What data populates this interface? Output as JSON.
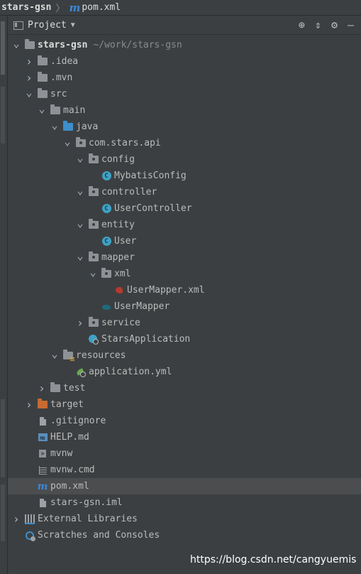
{
  "breadcrumb": {
    "project": "stars-gsn",
    "file": "pom.xml"
  },
  "panel": {
    "title": "Project"
  },
  "tree": [
    {
      "id": "root",
      "label": "stars-gsn",
      "path": "~/work/stars-gsn",
      "depth": 0,
      "arrow": "down",
      "icon": "module",
      "bold": true
    },
    {
      "id": "idea",
      "label": ".idea",
      "depth": 1,
      "arrow": "right",
      "icon": "folder"
    },
    {
      "id": "mvn",
      "label": ".mvn",
      "depth": 1,
      "arrow": "right",
      "icon": "folder"
    },
    {
      "id": "src",
      "label": "src",
      "depth": 1,
      "arrow": "down",
      "icon": "folder"
    },
    {
      "id": "main",
      "label": "main",
      "depth": 2,
      "arrow": "down",
      "icon": "folder"
    },
    {
      "id": "java",
      "label": "java",
      "depth": 3,
      "arrow": "down",
      "icon": "folder-blue"
    },
    {
      "id": "pkg",
      "label": "com.stars.api",
      "depth": 4,
      "arrow": "down",
      "icon": "package"
    },
    {
      "id": "config",
      "label": "config",
      "depth": 5,
      "arrow": "down",
      "icon": "package"
    },
    {
      "id": "mybatisconfig",
      "label": "MybatisConfig",
      "depth": 6,
      "icon": "class"
    },
    {
      "id": "controller",
      "label": "controller",
      "depth": 5,
      "arrow": "down",
      "icon": "package"
    },
    {
      "id": "usercontroller",
      "label": "UserController",
      "depth": 6,
      "icon": "class"
    },
    {
      "id": "entity",
      "label": "entity",
      "depth": 5,
      "arrow": "down",
      "icon": "package"
    },
    {
      "id": "user",
      "label": "User",
      "depth": 6,
      "icon": "class"
    },
    {
      "id": "mapper",
      "label": "mapper",
      "depth": 5,
      "arrow": "down",
      "icon": "package"
    },
    {
      "id": "xml",
      "label": "xml",
      "depth": 6,
      "arrow": "down",
      "icon": "package"
    },
    {
      "id": "usermapperxml",
      "label": "UserMapper.xml",
      "depth": 7,
      "icon": "mybatis-xml"
    },
    {
      "id": "usermapper",
      "label": "UserMapper",
      "depth": 6,
      "icon": "mybatis-mapper"
    },
    {
      "id": "service",
      "label": "service",
      "depth": 5,
      "arrow": "right",
      "icon": "package"
    },
    {
      "id": "starsapp",
      "label": "StarsApplication",
      "depth": 5,
      "icon": "spring-app"
    },
    {
      "id": "resources",
      "label": "resources",
      "depth": 3,
      "arrow": "down",
      "icon": "resources"
    },
    {
      "id": "appyml",
      "label": "application.yml",
      "depth": 4,
      "icon": "spring-yml"
    },
    {
      "id": "test",
      "label": "test",
      "depth": 2,
      "arrow": "right",
      "icon": "folder"
    },
    {
      "id": "target",
      "label": "target",
      "depth": 1,
      "arrow": "right",
      "icon": "folder-orange"
    },
    {
      "id": "gitignore",
      "label": ".gitignore",
      "depth": 1,
      "icon": "file"
    },
    {
      "id": "helpmd",
      "label": "HELP.md",
      "depth": 1,
      "icon": "md"
    },
    {
      "id": "mvnw",
      "label": "mvnw",
      "depth": 1,
      "icon": "terminal"
    },
    {
      "id": "mvnwcmd",
      "label": "mvnw.cmd",
      "depth": 1,
      "icon": "text"
    },
    {
      "id": "pomxml",
      "label": "pom.xml",
      "depth": 1,
      "icon": "maven",
      "selected": true
    },
    {
      "id": "iml",
      "label": "stars-gsn.iml",
      "depth": 1,
      "icon": "file"
    },
    {
      "id": "extlibs",
      "label": "External Libraries",
      "depth": 0,
      "arrow": "right",
      "icon": "libs"
    },
    {
      "id": "scratches",
      "label": "Scratches and Consoles",
      "depth": 0,
      "icon": "scratch"
    }
  ],
  "watermark": "https://blog.csdn.net/cangyuemis"
}
